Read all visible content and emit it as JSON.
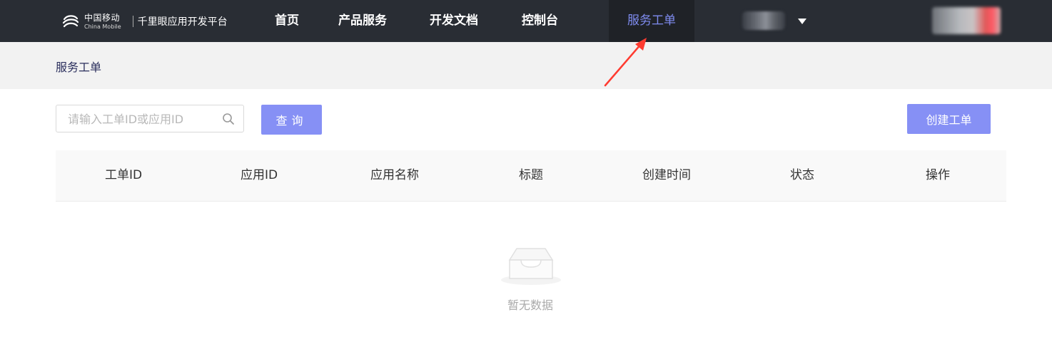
{
  "header": {
    "logo": {
      "cn_name": "中国移动",
      "en_name": "China Mobile",
      "platform_name": "千里眼应用开发平台"
    },
    "nav": [
      {
        "label": "首页"
      },
      {
        "label": "产品服务"
      },
      {
        "label": "开发文档"
      },
      {
        "label": "控制台"
      },
      {
        "label": "服务工单",
        "active": true
      }
    ],
    "colors": {
      "background": "#292d34",
      "active_background": "#1f2227",
      "active_text": "#7f8cf0"
    }
  },
  "breadcrumb": {
    "current": "服务工单"
  },
  "toolbar": {
    "search_placeholder": "请输入工单ID或应用ID",
    "search_value": "",
    "query_label": "查询",
    "create_label": "创建工单"
  },
  "table": {
    "columns": [
      "工单ID",
      "应用ID",
      "应用名称",
      "标题",
      "创建时间",
      "状态",
      "操作"
    ],
    "rows": []
  },
  "empty": {
    "text": "暂无数据"
  },
  "colors": {
    "primary": "#8690f5",
    "annotation_arrow": "#ff3b30"
  }
}
